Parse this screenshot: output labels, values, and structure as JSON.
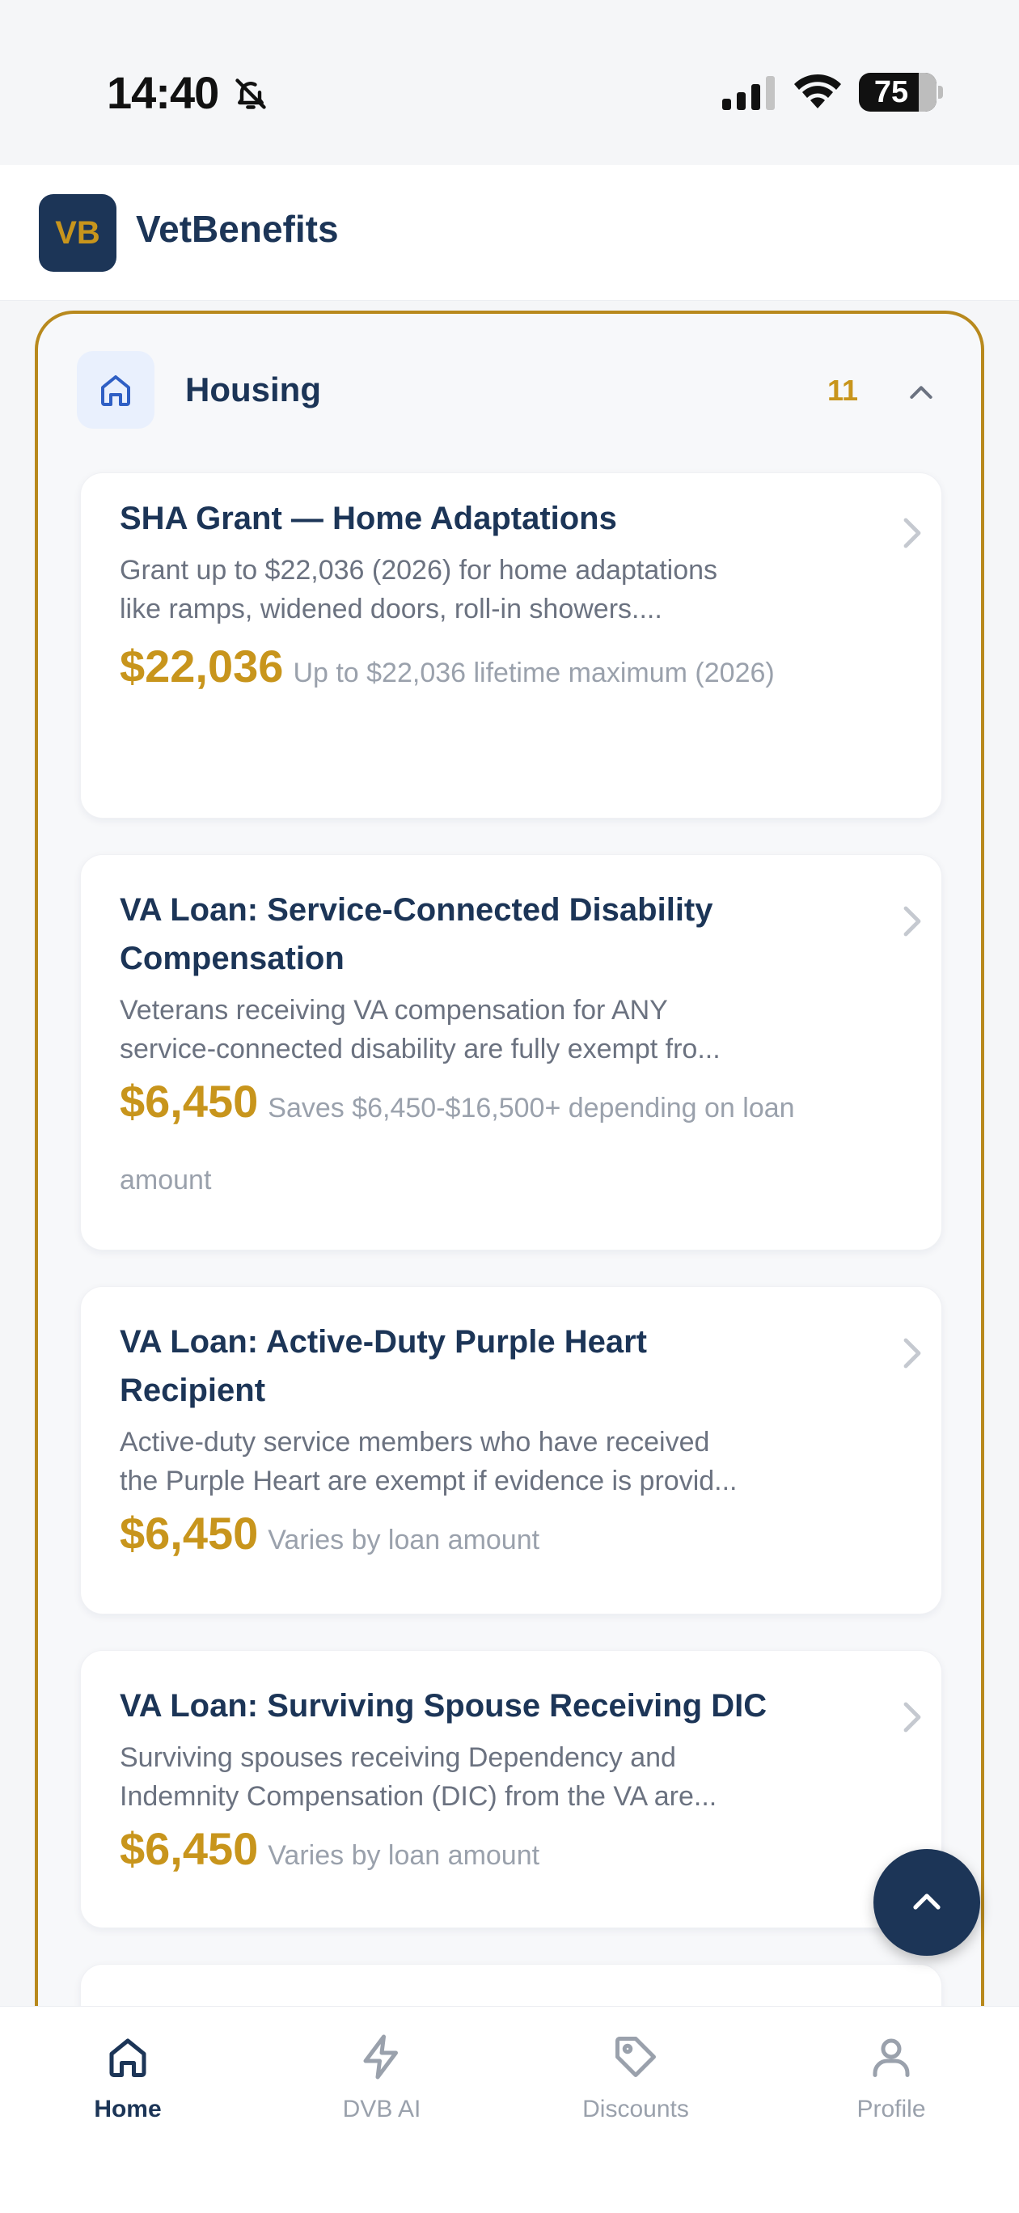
{
  "status_bar": {
    "time": "14:40",
    "battery": "75"
  },
  "header": {
    "logo_text": "VB",
    "app_name": "VetBenefits"
  },
  "section": {
    "title": "Housing",
    "count": "11",
    "icon": "home-icon"
  },
  "cards": [
    {
      "title_lines": [
        "SHA Grant — Home Adaptations"
      ],
      "desc_lines": [
        "Grant up to $22,036 (2026) for home adaptations",
        "like ramps, widened doors, roll-in showers...."
      ],
      "amount": "$22,036",
      "note": "Up to $22,036 lifetime maximum (2026)"
    },
    {
      "title_lines": [
        "VA Loan: Service-Connected Disability",
        "Compensation"
      ],
      "desc_lines": [
        "Veterans receiving VA compensation for ANY",
        "service-connected disability are fully exempt fro..."
      ],
      "amount": "$6,450",
      "note": "Saves $6,450-$16,500+ depending on loan amount"
    },
    {
      "title_lines": [
        "VA Loan: Active-Duty Purple Heart",
        "Recipient"
      ],
      "desc_lines": [
        "Active-duty service members who have received",
        "the Purple Heart are exempt if evidence is provid..."
      ],
      "amount": "$6,450",
      "note": "Varies by loan amount"
    },
    {
      "title_lines": [
        "VA Loan: Surviving Spouse Receiving DIC"
      ],
      "desc_lines": [
        "Surviving spouses receiving Dependency and",
        "Indemnity Compensation (DIC) from the VA are..."
      ],
      "amount": "$6,450",
      "note": "Varies by loan amount"
    }
  ],
  "bottom_nav": [
    {
      "label": "Home",
      "icon": "home-icon",
      "active": true
    },
    {
      "label": "DVB AI",
      "icon": "lightning-icon",
      "active": false
    },
    {
      "label": "Discounts",
      "icon": "tag-icon",
      "active": false
    },
    {
      "label": "Profile",
      "icon": "user-icon",
      "active": false
    }
  ],
  "colors": {
    "navy": "#1c3557",
    "gold": "#c8951c",
    "border_gold": "#b8891d",
    "muted": "#9aa1ac"
  }
}
